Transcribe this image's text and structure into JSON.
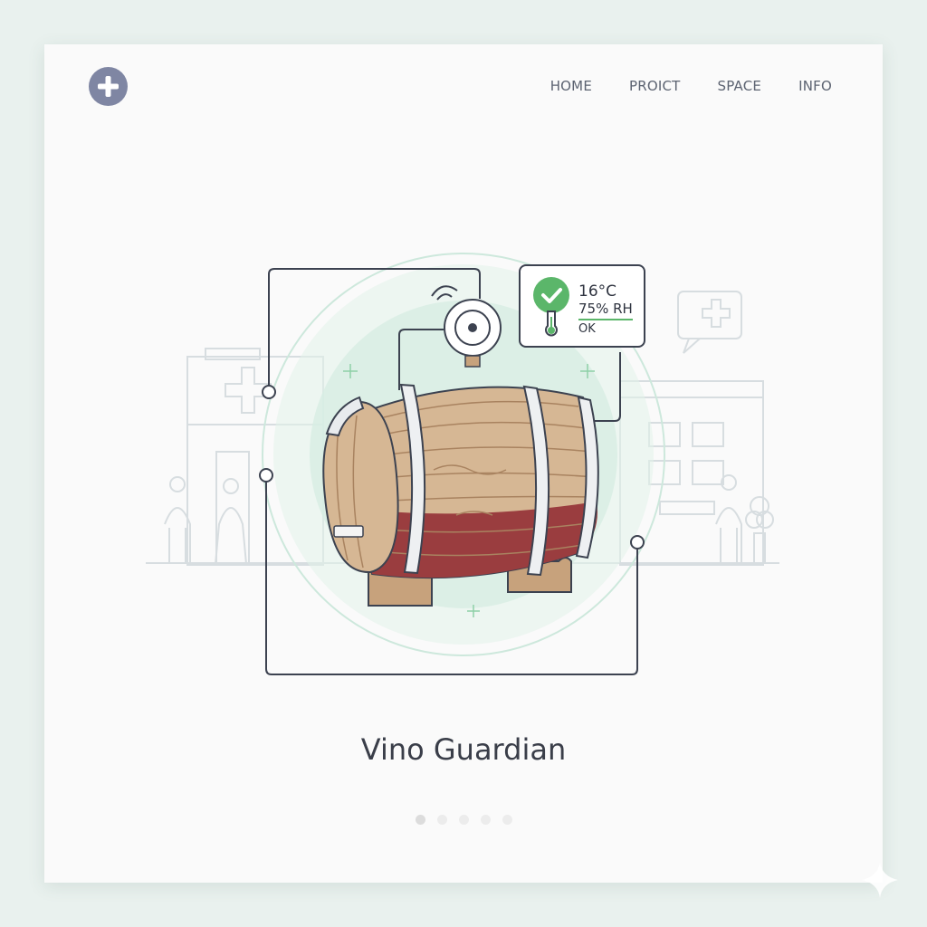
{
  "header": {
    "logo_icon": "plus-icon",
    "nav": [
      "HOME",
      "PROICT",
      "SPACE",
      "INFO"
    ]
  },
  "sensor_status": {
    "status_icon": "check-icon",
    "temperature": "16°C",
    "humidity": "75% RH",
    "state": "OK",
    "humidity_fill": 1.0
  },
  "app": {
    "title": "Vino Guardian"
  },
  "pager": {
    "count": 5,
    "active_index": 0
  },
  "colors": {
    "background": "#e9f1ee",
    "card": "#fafafa",
    "logo": "#7f86a3",
    "accent_green": "#5bb66a",
    "wine": "#9a3d3f",
    "wood": "#c7a27c",
    "outline": "#3c4250",
    "text": "#3a3e49"
  }
}
